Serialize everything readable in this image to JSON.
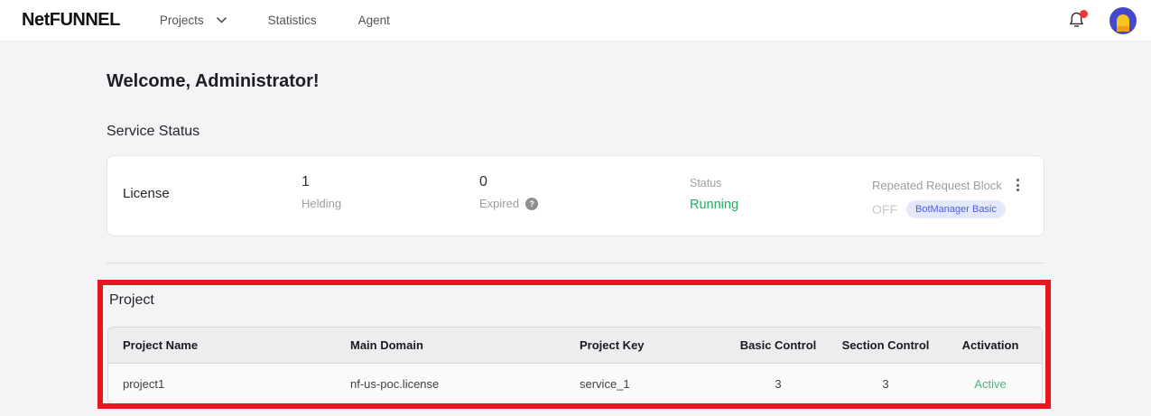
{
  "brand": {
    "logo_text": "NetFUNNEL"
  },
  "nav": {
    "items": [
      {
        "label": "Projects",
        "has_dropdown": true
      },
      {
        "label": "Statistics",
        "has_dropdown": false
      },
      {
        "label": "Agent",
        "has_dropdown": false
      }
    ]
  },
  "header_icons": {
    "notification": "bell-icon-with-red-dot",
    "avatar": "user-avatar"
  },
  "page": {
    "welcome_title": "Welcome, Administrator!",
    "service_status_title": "Service Status",
    "project_section_title": "Project"
  },
  "license_card": {
    "title": "License",
    "stats": [
      {
        "value": "1",
        "label": "Helding"
      },
      {
        "value": "0",
        "label": "Expired",
        "has_help_icon": true
      }
    ],
    "help_icon_glyph": "?",
    "status": {
      "label": "Status",
      "value": "Running",
      "color": "#1fae63"
    },
    "repeated_request_block": {
      "label": "Repeated Request Block",
      "state": "OFF",
      "badge": "BotManager Basic",
      "badge_bg": "#e4e8fb",
      "badge_color": "#4c5ce8"
    }
  },
  "project_table": {
    "columns": [
      "Project Name",
      "Main Domain",
      "Project Key",
      "Basic Control",
      "Section Control",
      "Activation"
    ],
    "rows": [
      {
        "project_name": "project1",
        "main_domain": "nf-us-poc.license",
        "project_key": "service_1",
        "basic_control": "3",
        "section_control": "3",
        "activation": "Active",
        "activation_color": "#4db580"
      }
    ]
  },
  "annotation": {
    "highlight_border_color": "#e8171f"
  }
}
